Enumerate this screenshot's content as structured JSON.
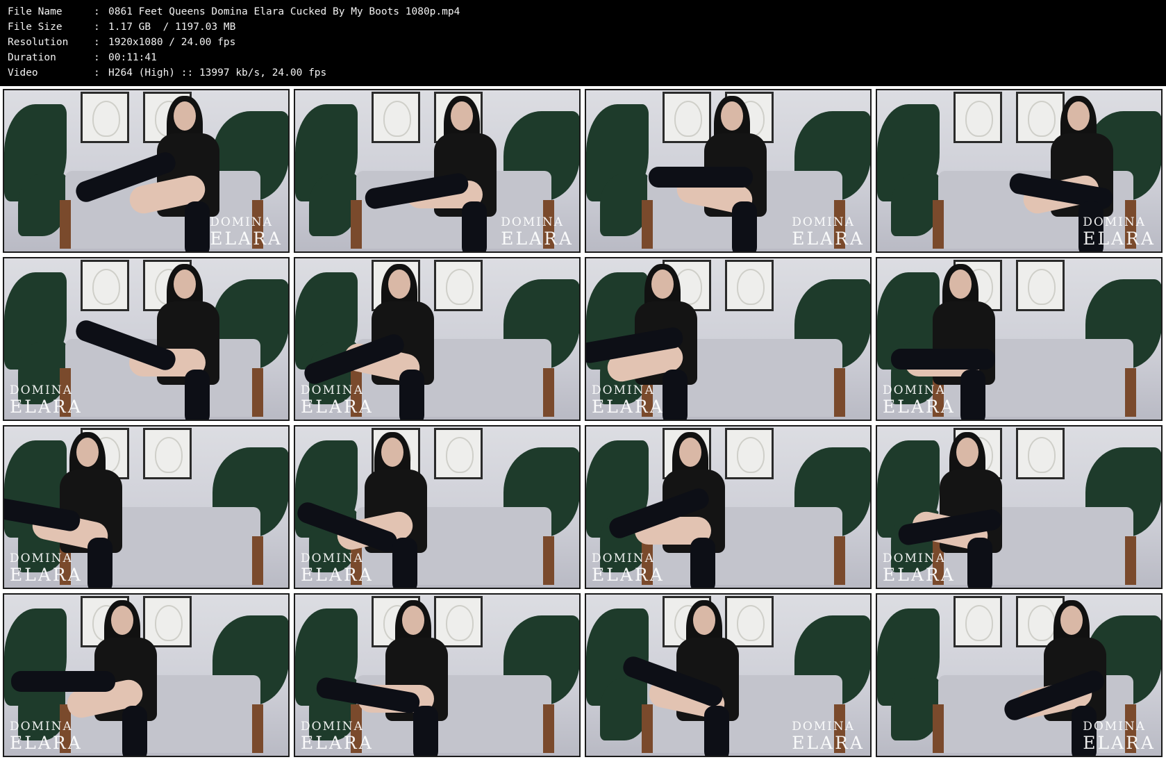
{
  "info": [
    {
      "key": "File Name",
      "sep": ":",
      "value": "0861 Feet Queens Domina Elara Cucked By My Boots 1080p.mp4"
    },
    {
      "key": "File Size",
      "sep": ":",
      "value": "1.17 GB  / 1197.03 MB"
    },
    {
      "key": "Resolution",
      "sep": ":",
      "value": "1920x1080 / 24.00 fps"
    },
    {
      "key": "Duration",
      "sep": ":",
      "value": "00:11:41"
    },
    {
      "key": "Video",
      "sep": ":",
      "value": "H264 (High) :: 13997 kb/s, 24.00 fps"
    }
  ],
  "watermark": {
    "line1": "DOMINA",
    "line2": "ELARA"
  },
  "thumbnails": [
    {
      "watermark_side": "right"
    },
    {
      "watermark_side": "right"
    },
    {
      "watermark_side": "right"
    },
    {
      "watermark_side": "right"
    },
    {
      "watermark_side": "left"
    },
    {
      "watermark_side": "left"
    },
    {
      "watermark_side": "left"
    },
    {
      "watermark_side": "left"
    },
    {
      "watermark_side": "left"
    },
    {
      "watermark_side": "left"
    },
    {
      "watermark_side": "left"
    },
    {
      "watermark_side": "left"
    },
    {
      "watermark_side": "left"
    },
    {
      "watermark_side": "left"
    },
    {
      "watermark_side": "right"
    },
    {
      "watermark_side": "right"
    }
  ]
}
